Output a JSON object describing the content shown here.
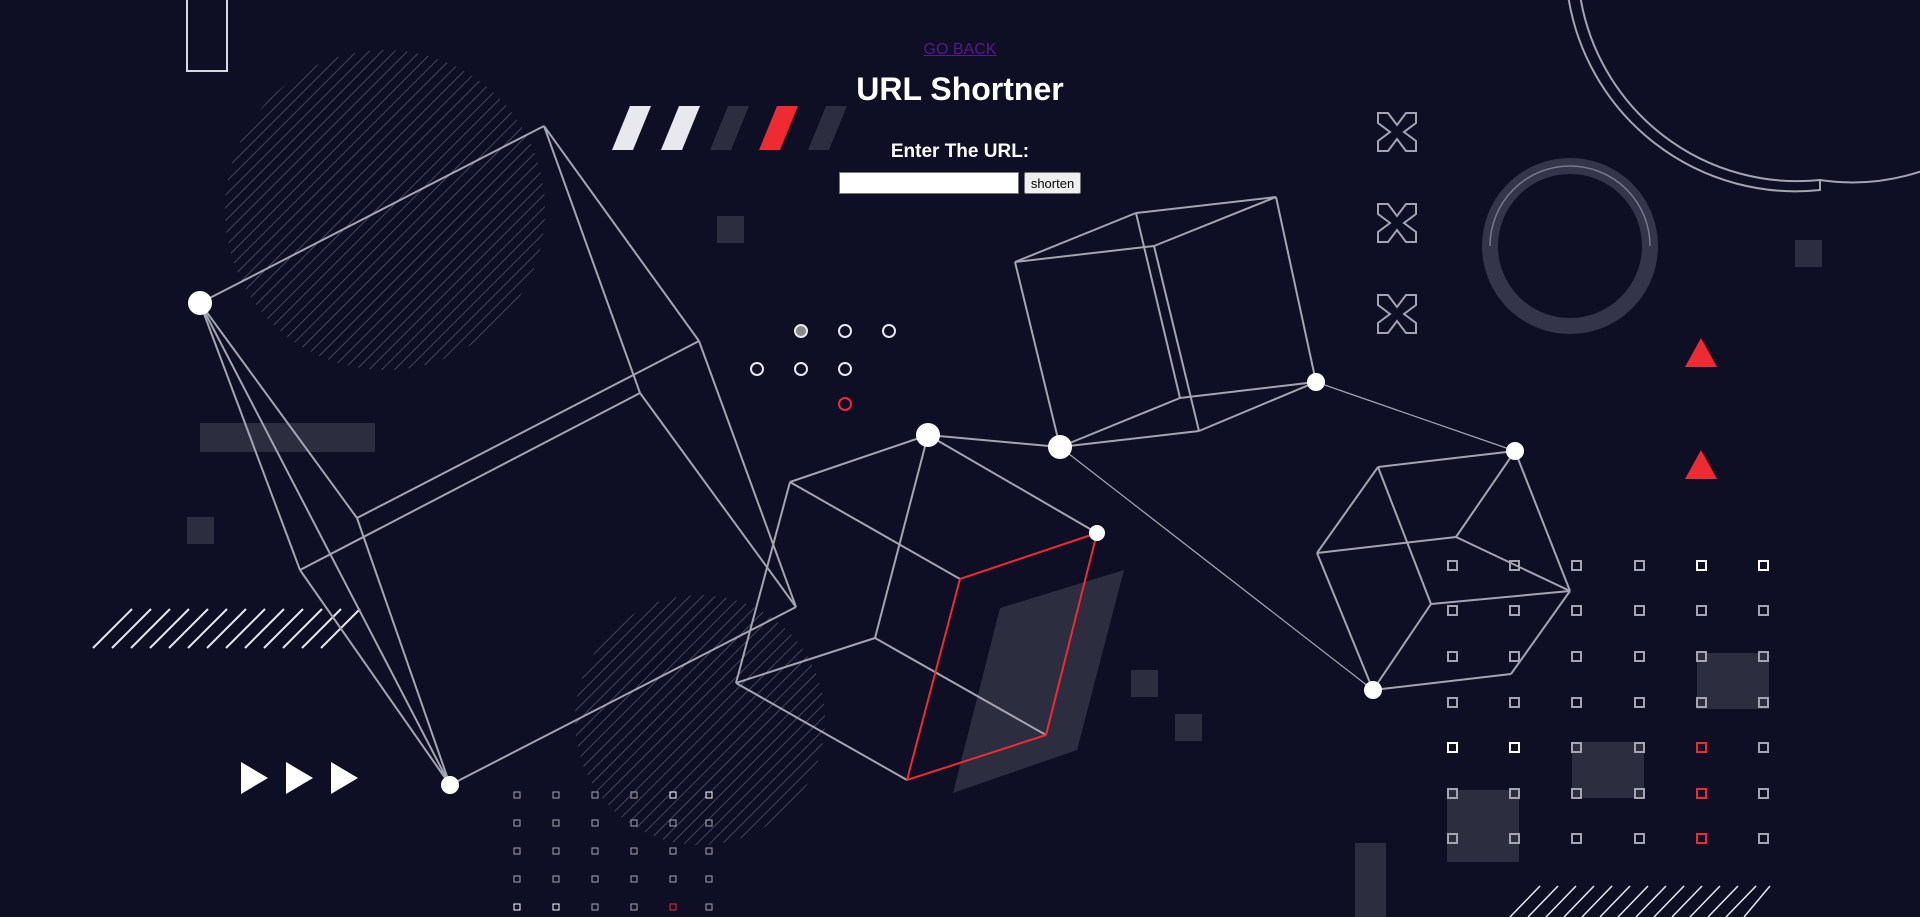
{
  "nav": {
    "back_label": "GO BACK"
  },
  "header": {
    "title": "URL Shortner"
  },
  "form": {
    "label": "Enter The URL:",
    "input_value": "",
    "input_placeholder": "",
    "submit_label": "shorten"
  },
  "colors": {
    "background": "#0e0e24",
    "line": "#a5a5b0",
    "accent": "#ee2a32",
    "block": "#2d2d40",
    "white": "#ffffff"
  }
}
